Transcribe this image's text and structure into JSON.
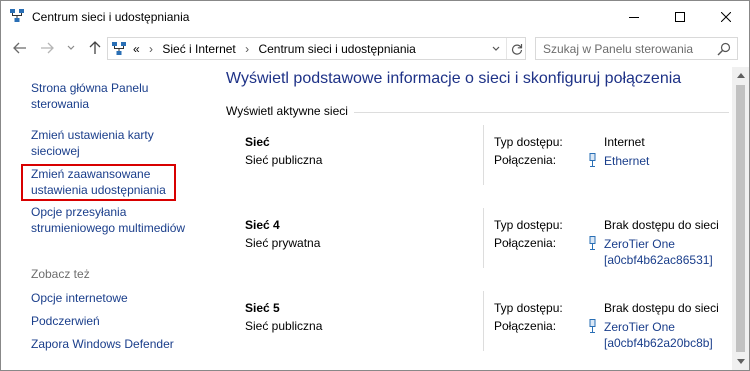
{
  "window": {
    "title": "Centrum sieci i udostępniania"
  },
  "address": {
    "prefix": "«",
    "crumbs": [
      "Sieć i Internet",
      "Centrum sieci i udostępniania"
    ],
    "separator": "›"
  },
  "search": {
    "placeholder": "Szukaj w Panelu sterowania"
  },
  "left_pane": {
    "links": [
      {
        "label": "Strona główna Panelu sterowania"
      },
      {
        "label": "Zmień ustawienia karty sieciowej"
      },
      {
        "label": "Zmień zaawansowane ustawienia udostępniania"
      },
      {
        "label": "Opcje przesyłania strumieniowego multimediów"
      }
    ],
    "see_also_label": "Zobacz też",
    "see_also": [
      {
        "label": "Opcje internetowe"
      },
      {
        "label": "Podczerwień"
      },
      {
        "label": "Zapora Windows Defender"
      }
    ]
  },
  "main": {
    "title": "Wyświetl podstawowe informacje o sieci i skonfiguruj połączenia",
    "section_heading": "Wyświetl aktywne sieci",
    "access_label": "Typ dostępu:",
    "connections_label": "Połączenia:",
    "networks": [
      {
        "name": "Sieć",
        "kind": "Sieć publiczna",
        "access": "Internet",
        "connection": "Ethernet",
        "connection_sub": ""
      },
      {
        "name": "Sieć 4",
        "kind": "Sieć prywatna",
        "access": "Brak dostępu do sieci",
        "connection": "ZeroTier One",
        "connection_sub": "[a0cbf4b62ac86531]"
      },
      {
        "name": "Sieć 5",
        "kind": "Sieć publiczna",
        "access": "Brak dostępu do sieci",
        "connection": "ZeroTier One",
        "connection_sub": "[a0cbf4b62a20bc8b]"
      }
    ]
  },
  "colors": {
    "link": "#1a3e8b",
    "title": "#1e3287",
    "highlight": "#d80000"
  }
}
